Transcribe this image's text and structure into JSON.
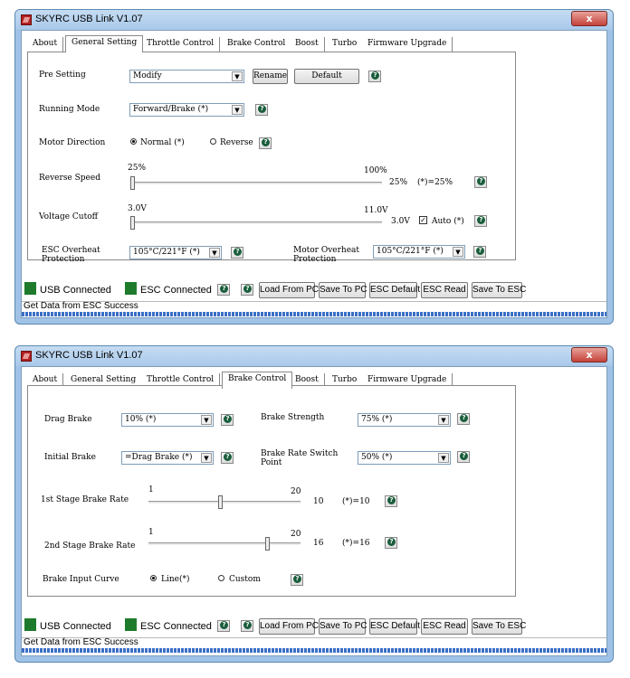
{
  "window_title": "SKYRC USB Link V1.07",
  "close_glyph": "x",
  "tabs": [
    "About",
    "General Setting",
    "Throttle Control",
    "Brake Control",
    "Boost",
    "Turbo",
    "Firmware Upgrade"
  ],
  "general": {
    "pre_setting": {
      "label": "Pre Setting",
      "value": "Modify",
      "rename": "Rename",
      "default": "Default"
    },
    "running_mode": {
      "label": "Running Mode",
      "value": "Forward/Brake (*)"
    },
    "motor_direction": {
      "label": "Motor Direction",
      "normal": "Normal (*)",
      "reverse": "Reverse",
      "selected": "Normal (*)"
    },
    "reverse_speed": {
      "label": "Reverse Speed",
      "min": "25%",
      "max": "100%",
      "value": "25%",
      "default_note": "(*)=25%",
      "level": 0
    },
    "voltage_cutoff": {
      "label": "Voltage Cutoff",
      "min": "3.0V",
      "max": "11.0V",
      "value": "3.0V",
      "auto_label": "Auto (*)",
      "auto_checked": true,
      "level": 0
    },
    "esc_overheat": {
      "label1": "ESC Overheat",
      "label2": "Protection",
      "value": "105°C/221°F (*)"
    },
    "motor_overheat": {
      "label1": "Motor Overheat",
      "label2": "Protection",
      "value": "105°C/221°F (*)"
    }
  },
  "brake": {
    "drag_brake": {
      "label": "Drag Brake",
      "value": "10% (*)"
    },
    "brake_strength": {
      "label": "Brake Strength",
      "value": "75% (*)"
    },
    "initial_brake": {
      "label": "Initial Brake",
      "value": "=Drag Brake (*)"
    },
    "brake_rate_switch": {
      "label1": "Brake Rate Switch",
      "label2": "Point",
      "value": "50% (*)"
    },
    "stage1": {
      "label": "1st Stage Brake Rate",
      "min": "1",
      "max": "20",
      "value": "10",
      "default_note": "(*)=10",
      "level": 0.47
    },
    "stage2": {
      "label": "2nd Stage Brake Rate",
      "min": "1",
      "max": "20",
      "value": "16",
      "default_note": "(*)=16",
      "level": 0.79
    },
    "input_curve": {
      "label": "Brake Input Curve",
      "line": "Line(*)",
      "custom": "Custom",
      "selected": "Line(*)"
    }
  },
  "status": {
    "usb": "USB Connected",
    "esc": "ESC Connected",
    "led_color": "#1e7b2c",
    "buttons": [
      "Load From PC",
      "Save To PC",
      "ESC Default",
      "ESC Read",
      "Save To ESC"
    ],
    "message": "Get Data from ESC Success"
  }
}
